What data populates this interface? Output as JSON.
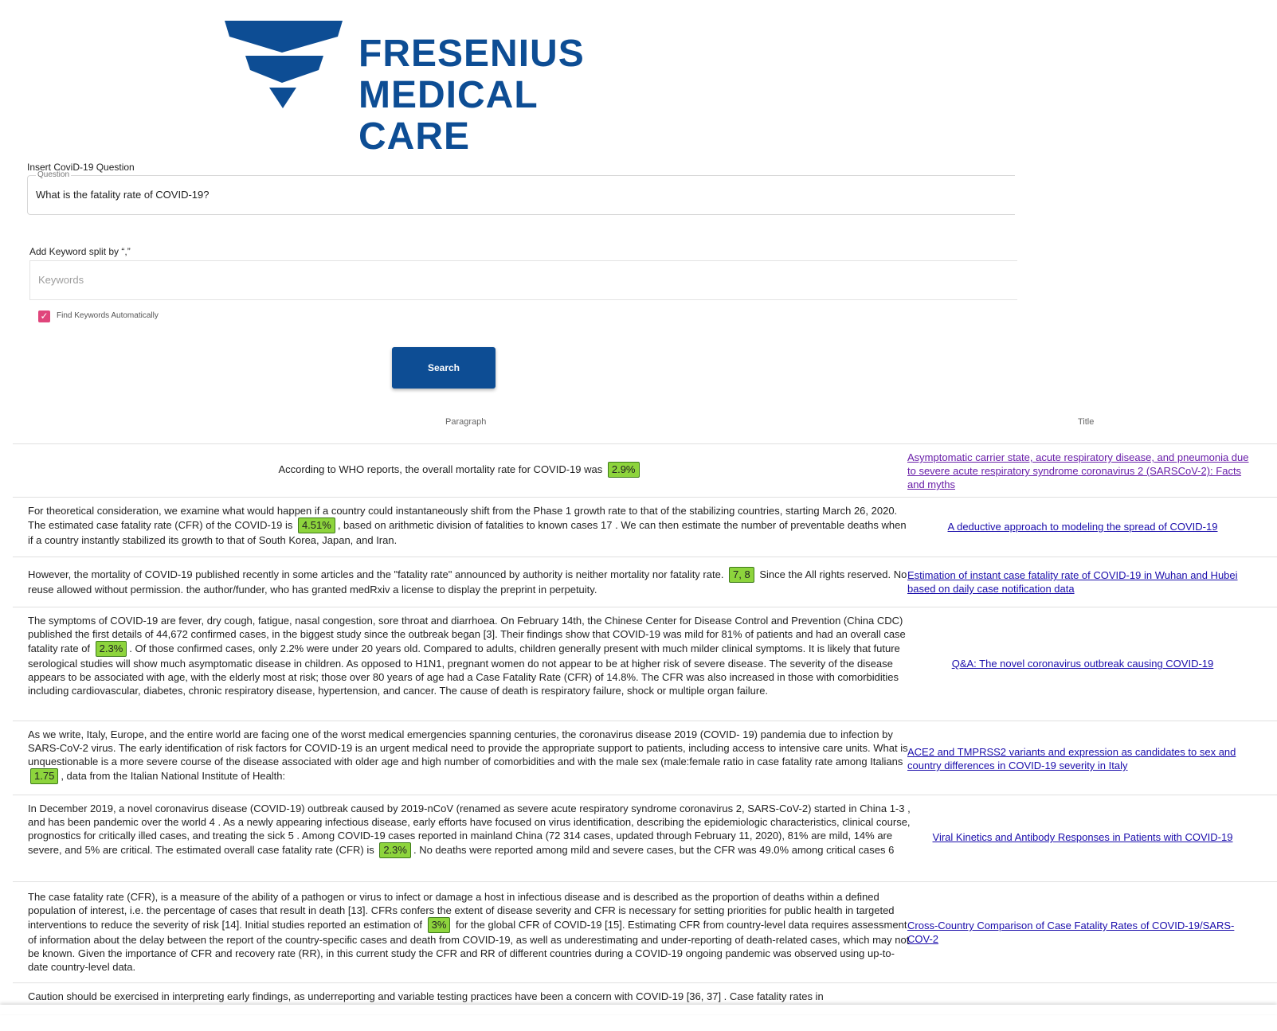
{
  "logo": {
    "line1": "FRESENIUS",
    "line2": "MEDICAL CARE",
    "color": "#0d4d94"
  },
  "question": {
    "title": "Insert CoviD-19 Question",
    "legend": "Question",
    "value": "What is the fatality rate of COVID-19?"
  },
  "keywords": {
    "title": "Add Keyword split by “,”",
    "placeholder": "Keywords",
    "auto_label": "Find Keywords Automatically",
    "auto_checked": true
  },
  "search_label": "Search",
  "table": {
    "col_paragraph": "Paragraph",
    "col_title": "Title",
    "rows": [
      {
        "before": "According to WHO reports, the overall mortality rate for COVID-19 was ",
        "highlight": "2.9%",
        "after": "",
        "title": "Asymptomatic carrier state, acute respiratory disease, and pneumonia due to severe acute respiratory syndrome coronavirus 2 (SARSCoV-2): Facts and myths"
      },
      {
        "before": "For theoretical consideration, we examine what would happen if a country could instantaneously shift from the Phase 1 growth rate to that of the stabilizing countries, starting March 26, 2020. The estimated case fatality rate (CFR) of the COVID-19 is ",
        "highlight": "4.51%",
        "after": ", based on arithmetic division of fatalities to known cases 17 . We can then estimate the number of preventable deaths when if a country instantly stabilized its growth to that of South Korea, Japan, and Iran.",
        "title": "A deductive approach to modeling the spread of COVID-19"
      },
      {
        "before": "However, the mortality of COVID-19 published recently in some articles and the \"fatality rate\" announced by authority is neither mortality nor fatality rate. ",
        "highlight": "7, 8",
        "after": " Since the All rights reserved. No reuse allowed without permission. the author/funder, who has granted medRxiv a license to display the preprint in perpetuity.",
        "title": "Estimation of instant case fatality rate of COVID-19 in Wuhan and Hubei based on daily case notification data"
      },
      {
        "before": "The symptoms of COVID-19 are fever, dry cough, fatigue, nasal congestion, sore throat and diarrhoea. On February 14th, the Chinese Center for Disease Control and Prevention (China CDC) published the first details of 44,672 confirmed cases, in the biggest study since the outbreak began [3]. Their findings show that COVID-19 was mild for 81% of patients and had an overall case fatality rate of ",
        "highlight": "2.3%",
        "after": ". Of those confirmed cases, only 2.2% were under 20 years old. Compared to adults, children generally present with much milder clinical symptoms. It is likely that future serological studies will show much asymptomatic disease in children. As opposed to H1N1, pregnant women do not appear to be at higher risk of severe disease. The severity of the disease appears to be associated with age, with the elderly most at risk; those over 80 years of age had a Case Fatality Rate (CFR) of 14.8%. The CFR was also increased in those with comorbidities including cardiovascular, diabetes, chronic respiratory disease, hypertension, and cancer. The cause of death is respiratory failure, shock or multiple organ failure.",
        "title": "Q&A: The novel coronavirus outbreak causing COVID-19"
      },
      {
        "before": "As we write, Italy, Europe, and the entire world are facing one of the worst medical emergencies spanning centuries, the coronavirus disease 2019 (COVID- 19) pandemia due to infection by SARS-CoV-2 virus. The early identification of risk factors for COVID-19 is an urgent medical need to provide the appropriate support to patients, including access to intensive care units. What is unquestionable is a more severe course of the disease associated with older age and high number of comorbidities and with the male sex (male:female ratio in case fatality rate among Italians ",
        "highlight": "1.75",
        "after": ", data from the Italian National Institute of Health:",
        "title": "ACE2 and TMPRSS2 variants and expression as candidates to sex and country differences in COVID-19 severity in Italy"
      },
      {
        "before": "In December 2019, a novel coronavirus disease (COVID-19) outbreak caused by 2019-nCoV (renamed as severe acute respiratory syndrome coronavirus 2, SARS-CoV-2) started in China 1-3 , and has been pandemic over the world 4 . As a newly appearing infectious disease, early efforts have focused on virus identification, describing the epidemiologic characteristics, clinical course, prognostics for critically illed cases, and treating the sick 5 . Among COVID-19 cases reported in mainland China (72 314 cases, updated through February 11, 2020), 81% are mild, 14% are severe, and 5% are critical. The estimated overall case fatality rate (CFR) is ",
        "highlight": "2.3%",
        "after": ". No deaths were reported among mild and severe cases, but the CFR was 49.0% among critical cases 6",
        "title": "Viral Kinetics and Antibody Responses in Patients with COVID-19"
      },
      {
        "before": "The case fatality rate (CFR), is a measure of the ability of a pathogen or virus to infect or damage a host in infectious disease and is described as the proportion of deaths within a defined population of interest, i.e. the percentage of cases that result in death [13]. CFRs confers the extent of disease severity and CFR is necessary for setting priorities for public health in targeted interventions to reduce the severity of risk [14]. Initial studies reported an estimation of ",
        "highlight": "3%",
        "after": " for the global CFR of COVID-19 [15]. Estimating CFR from country-level data requires assessment of information about the delay between the report of the country-specific cases and death from COVID-19, as well as underestimating and under-reporting of death-related cases, which may not be known. Given the importance of CFR and recovery rate (RR), in this current study the CFR and RR of different countries during a COVID-19 ongoing pandemic was observed using up-to-date country-level data.",
        "title": "Cross-Country Comparison of Case Fatality Rates of COVID-19/SARS-COV-2"
      },
      {
        "before": "Caution should be exercised in interpreting early findings, as underreporting and variable testing practices have been a concern with COVID-19 [36, 37] . Case fatality rates in",
        "highlight": "",
        "after": "",
        "title": ""
      }
    ]
  }
}
